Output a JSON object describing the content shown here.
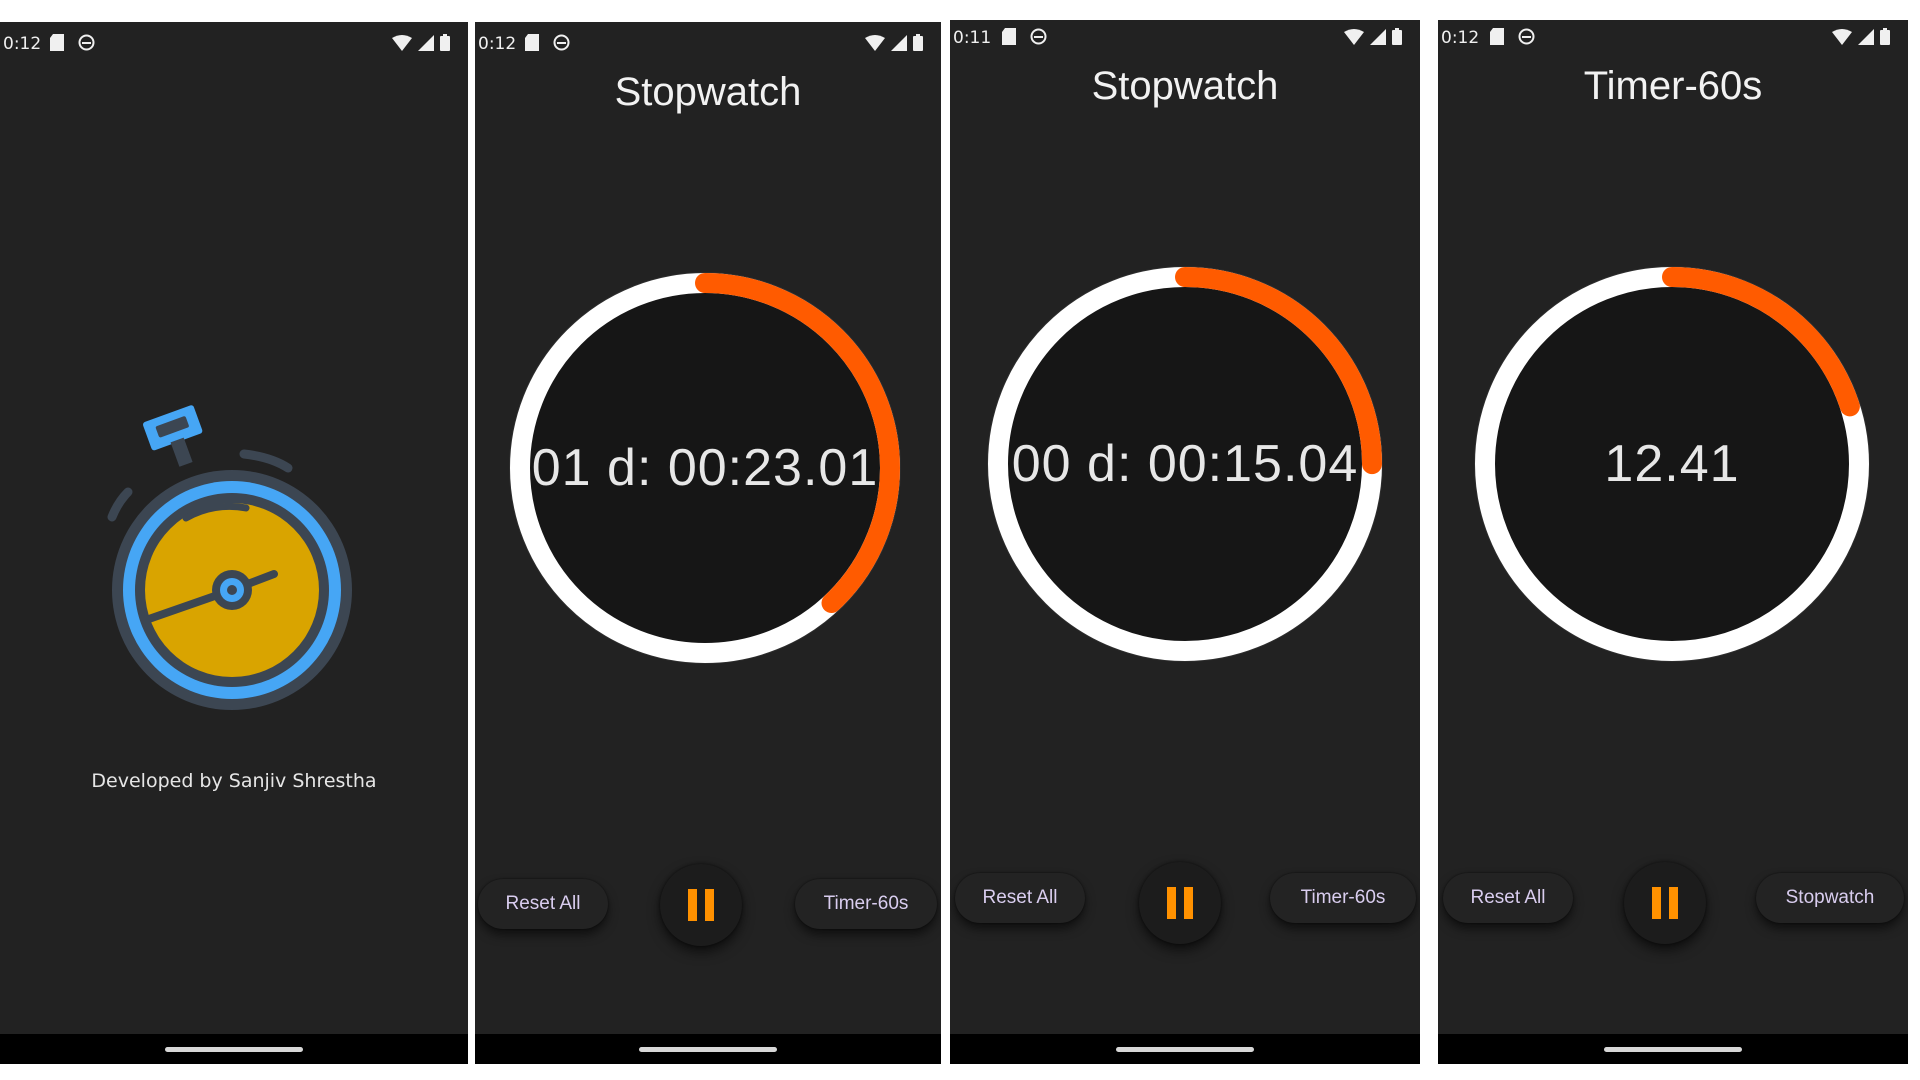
{
  "screens": [
    {
      "status_time": "0:12",
      "credit": "Developed by Sanjiv Shrestha",
      "logo_icon": "stopwatch-logo-icon"
    },
    {
      "status_time": "0:12",
      "title": "Stopwatch",
      "display": "01 d: 00:23.01",
      "progress_fraction": 0.38,
      "buttons": {
        "left": "Reset All",
        "right": "Timer-60s"
      }
    },
    {
      "status_time": "0:11",
      "title": "Stopwatch",
      "display": "00 d: 00:15.04",
      "progress_fraction": 0.25,
      "buttons": {
        "left": "Reset All",
        "right": "Timer-60s"
      }
    },
    {
      "status_time": "0:12",
      "title": "Timer-60s",
      "display": "12.41",
      "progress_fraction": 0.2,
      "buttons": {
        "left": "Reset All",
        "right": "Stopwatch"
      }
    }
  ],
  "colors": {
    "background": "#222222",
    "progress": "#ff5b00",
    "track": "#ffffff",
    "pause": "#ff9100",
    "logo_yellow": "#d9a400",
    "logo_blue": "#46a6f5",
    "logo_dark": "#3c4652"
  },
  "icons": [
    "sd-card-icon",
    "app-notification-icon",
    "wifi-icon",
    "signal-icon",
    "battery-icon",
    "pause-icon"
  ]
}
